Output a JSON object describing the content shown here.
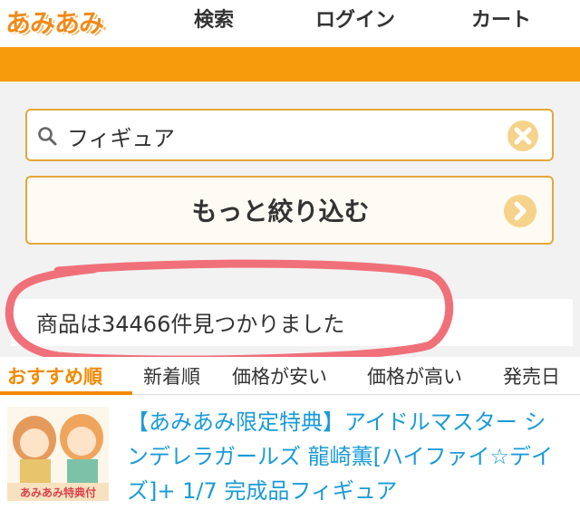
{
  "header": {
    "logo": "あみあみ",
    "nav": [
      "検索",
      "ログイン",
      "カート"
    ]
  },
  "search": {
    "value": "フィギュア",
    "refine_label": "もっと絞り込む"
  },
  "result": {
    "text": "商品は34466件見つかりました"
  },
  "sort": {
    "items": [
      "おすすめ順",
      "新着順",
      "価格が安い",
      "価格が高い",
      "発売日"
    ],
    "active_index": 0
  },
  "product": {
    "title": "【あみあみ限定特典】アイドルマスター シンデレラガールズ 龍崎薫[ハイファイ☆デイズ]+ 1/7 完成品フィギュア",
    "thumb_caption": "あみあみ特典付"
  },
  "colors": {
    "accent": "#f79b0c",
    "link": "#1a9bd7",
    "highlight": "#f0707a"
  }
}
